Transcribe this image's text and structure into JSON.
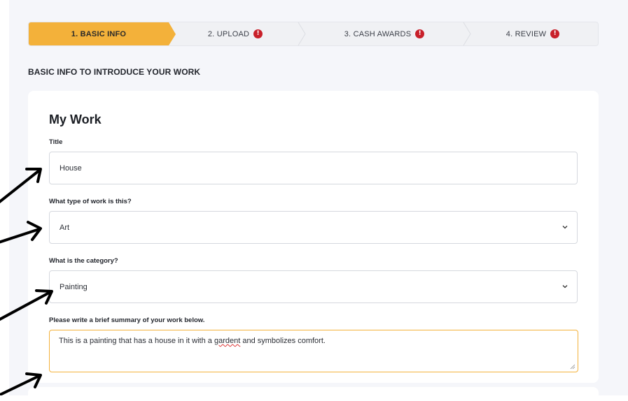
{
  "stepper": {
    "steps": [
      {
        "label": "1. BASIC INFO",
        "active": true,
        "warning": false
      },
      {
        "label": "2. UPLOAD",
        "active": false,
        "warning": true
      },
      {
        "label": "3. CASH AWARDS",
        "active": false,
        "warning": true
      },
      {
        "label": "4. REVIEW",
        "active": false,
        "warning": true
      }
    ],
    "warning_glyph": "!",
    "accent_color": "#f3b13a",
    "warning_color": "#c8202a"
  },
  "section_heading": "BASIC INFO TO INTRODUCE YOUR WORK",
  "card": {
    "title": "My Work",
    "fields": {
      "title": {
        "label": "Title",
        "value": "House"
      },
      "work_type": {
        "label": "What type of work is this?",
        "value": "Art"
      },
      "category": {
        "label": "What is the category?",
        "value": "Painting"
      },
      "summary": {
        "label": "Please write a brief summary of your work below.",
        "value_before": "This is a painting that has a house in it with a ",
        "value_misspelled": "gardent",
        "value_after": " and symbolizes comfort."
      }
    }
  },
  "icons": {
    "warning": "exclamation-circle-icon",
    "chevron": "chevron-down-icon",
    "annotation": "arrow-icon"
  }
}
